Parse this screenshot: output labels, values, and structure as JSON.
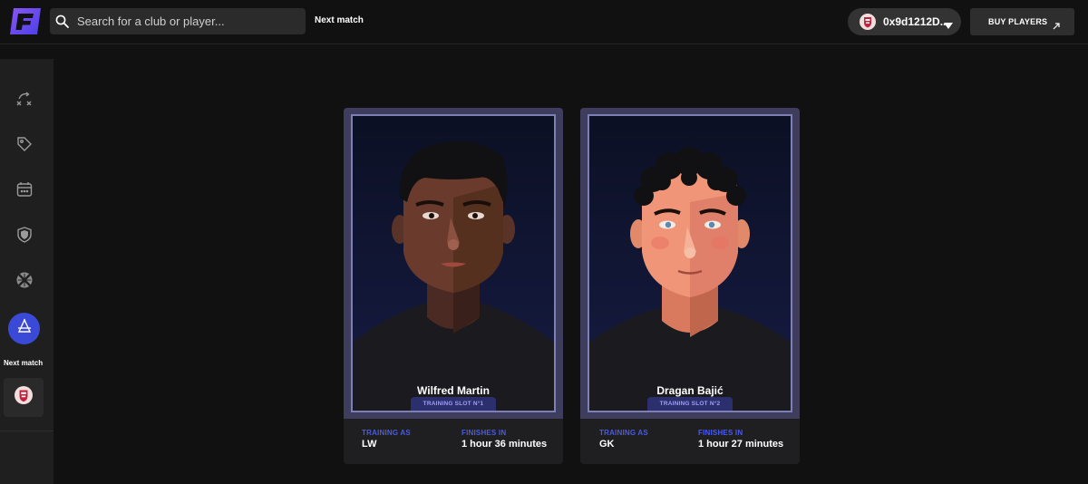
{
  "header": {
    "search_placeholder": "Search for a club or player...",
    "next_match_link": "Next match",
    "wallet_address": "0x9d1212D...",
    "buy_players_label": "BUY PLAYERS"
  },
  "sidebar": {
    "items": [
      {
        "icon": "tactics-icon"
      },
      {
        "icon": "tag-icon"
      },
      {
        "icon": "calendar-icon"
      },
      {
        "icon": "shield-icon"
      },
      {
        "icon": "crossed-icon"
      },
      {
        "icon": "training-icon",
        "active": true
      }
    ],
    "next_match_label": "Next match"
  },
  "cards": [
    {
      "player_name": "Wilfred Martin",
      "slot_label": "TRAINING SLOT N°1",
      "training_as_label": "TRAINING AS",
      "training_as_value": "LW",
      "finishes_in_label": "FINISHES IN",
      "finishes_in_value": "1 hour 36 minutes"
    },
    {
      "player_name": "Dragan Bajić",
      "slot_label": "TRAINING SLOT N°2",
      "training_as_label": "TRAINING AS",
      "training_as_value": "GK",
      "finishes_in_label": "FINISHES IN",
      "finishes_in_value": "1 hour 27 minutes"
    }
  ],
  "colors": {
    "brand": "#6a4df3",
    "accent": "#3b4ad6",
    "label_blue": "#4a5ae8",
    "background": "#111111"
  }
}
